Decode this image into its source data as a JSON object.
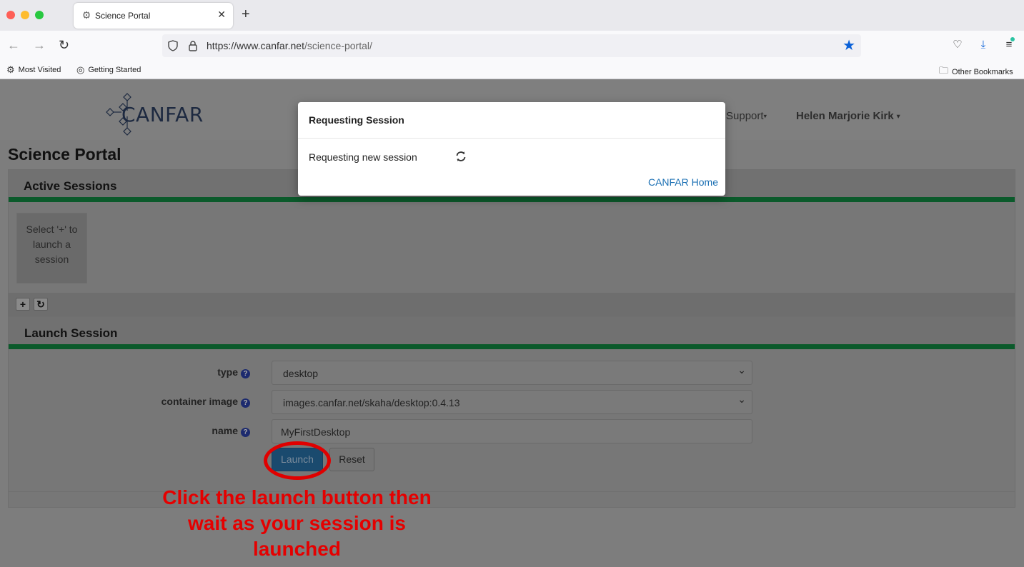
{
  "browser": {
    "tab_title": "Science Portal",
    "url_host": "https://www.canfar.net",
    "url_path": "/science-portal/",
    "bookmarks": [
      "Most Visited",
      "Getting Started"
    ],
    "other_bookmarks": "Other Bookmarks",
    "colors": {
      "accent": "#0a61d8"
    }
  },
  "header": {
    "logo_text": "CANFAR",
    "support_label": "Support",
    "user_label": "Helen Marjorie Kirk"
  },
  "page": {
    "title": "Science Portal"
  },
  "active_sessions": {
    "heading": "Active Sessions",
    "placeholder": "Select '+' to launch a session",
    "add_label": "+",
    "refresh_label": "↻"
  },
  "launch_session": {
    "heading": "Launch Session",
    "fields": {
      "type_label": "type",
      "type_value": "desktop",
      "image_label": "container image",
      "image_value": "images.canfar.net/skaha/desktop:0.4.13",
      "name_label": "name",
      "name_value": "MyFirstDesktop"
    },
    "launch_label": "Launch",
    "reset_label": "Reset"
  },
  "modal": {
    "title": "Requesting Session",
    "body": "Requesting new session",
    "link": "CANFAR Home"
  },
  "annotation": {
    "text": "Click the launch button then wait as your session is launched",
    "color": "#e50000"
  },
  "theme": {
    "panel_accent": "#0b5a2b",
    "help_icon": "#1c2a6e"
  }
}
